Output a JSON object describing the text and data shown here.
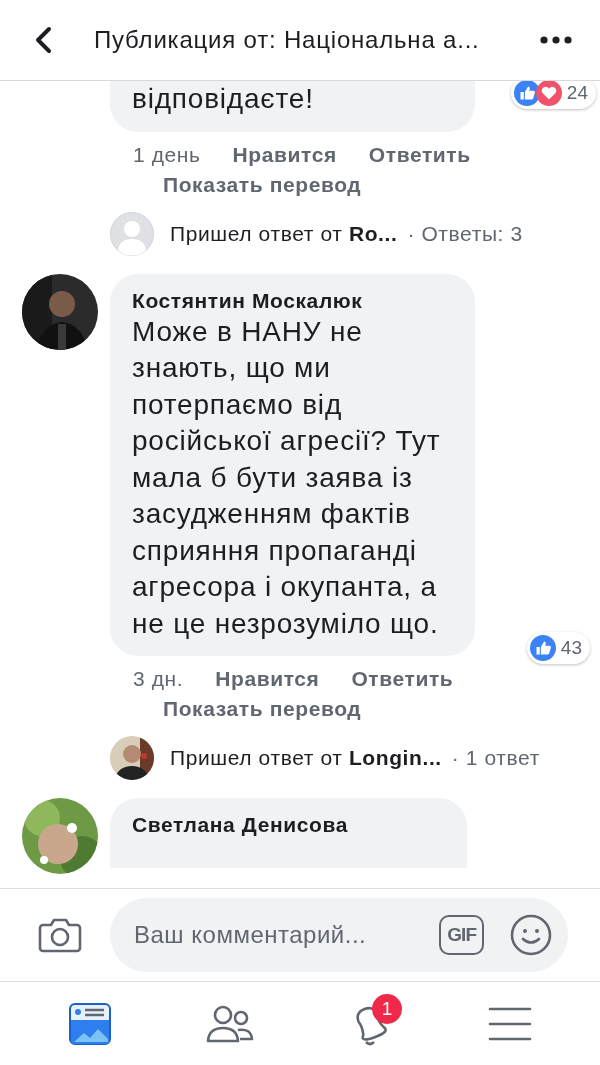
{
  "header": {
    "title": "Публикация от: Національна а..."
  },
  "comments": [
    {
      "text": "відповідаєте!",
      "reactions": {
        "types": [
          {
            "kind": "like"
          },
          {
            "kind": "love"
          }
        ],
        "count": "24"
      },
      "time": "1 день",
      "like_label": "Нравится",
      "reply_label": "Ответить",
      "translate_label": "Показать перевод",
      "replies_preview": {
        "avatar": {
          "kind": "placeholder"
        },
        "text": "Пришел ответ от **Ro...**",
        "count_text": "· Ответы: 3"
      }
    },
    {
      "author": "Костянтин Москалюк",
      "text": "Може в НАНУ не знають, що ми потерпаємо від російської агресії? Тут мала б бути заява із засудженням фактів сприяння пропаганді агресора і окупанта, а не це незрозуміло що.",
      "reactions": {
        "types": [
          {
            "kind": "like"
          }
        ],
        "count": "43"
      },
      "time": "3 дн.",
      "like_label": "Нравится",
      "reply_label": "Ответить",
      "translate_label": "Показать перевод",
      "replies_preview": {
        "text": "Пришел ответ от **Longin...**",
        "count_text": "· 1 ответ"
      }
    },
    {
      "author": "Светлана Денисова"
    }
  ],
  "composer": {
    "placeholder": "Ваш комментарий...",
    "gif_label": "GIF"
  },
  "tabbar": [
    {
      "kind": "feed",
      "selected": true
    },
    {
      "kind": "friends",
      "selected": false
    },
    {
      "kind": "notifications",
      "selected": false,
      "badge": "1"
    },
    {
      "kind": "menu",
      "selected": false
    }
  ]
}
